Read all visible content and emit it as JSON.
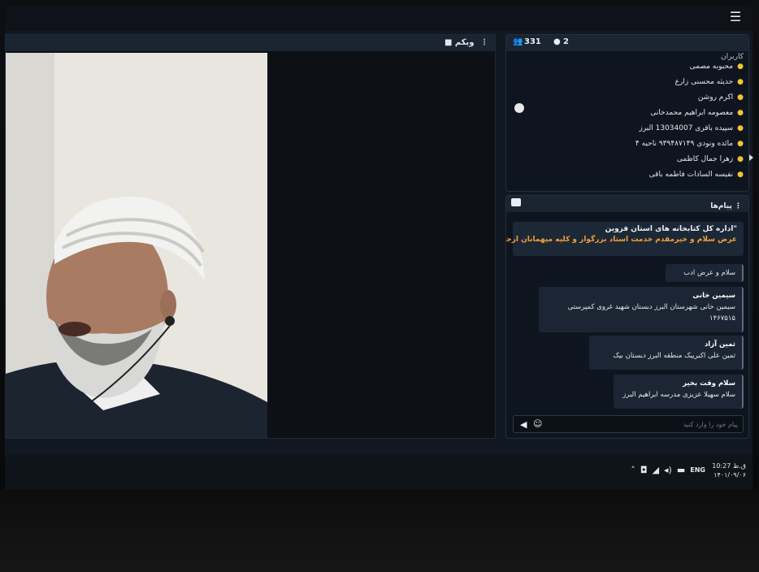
{
  "webcam": {
    "title": "وبکم"
  },
  "users": {
    "title": "کاربران",
    "count_all": "331",
    "count_speakers": "2",
    "list": [
      "محبوبه مصمی",
      "حدیثه محسنی زارع",
      "اکرم روشن",
      "معصومه ابراهیم محمدخانی",
      "سپیده باقری 13034007 البرز",
      "مائده ونودی ۹۳۹۴۸۷۱۴۹ ناحیه ۴",
      "زهرا جمال کاظمی",
      "نفیسه السادات فاطمه باقی"
    ]
  },
  "chat": {
    "title": "پیام‌ها",
    "pinned_line1": "\"اداره کل کتابخانه های استان قزوین",
    "pinned_line2": "عرض سلام و خیرمقدم خدمت استاد بزرگوار و کلیه میهمانان ارجمند",
    "messages": [
      {
        "name": "",
        "text": "سلام و عرض ادب"
      },
      {
        "name": "سیمین خانی",
        "text": "سیمین خانی شهرستان البرز دبستان شهید غروی کمپرستی ۱۴۶۷۵۱۵"
      },
      {
        "name": "ثمین آزاد",
        "text": "ثمین علی اکبرییک منطقه البرز دبستان بیک"
      },
      {
        "name": "سلام وقت بخیر",
        "text": "سلام سهیلا عزیزی مدرسه ابراهیم البرز"
      }
    ],
    "input_placeholder": "پیام خود را وارد کنید"
  },
  "taskbar": {
    "lang": "ENG",
    "time": "10:27 ق.ظ",
    "date": "۱۴۰۱/۰۹/۰۶"
  }
}
